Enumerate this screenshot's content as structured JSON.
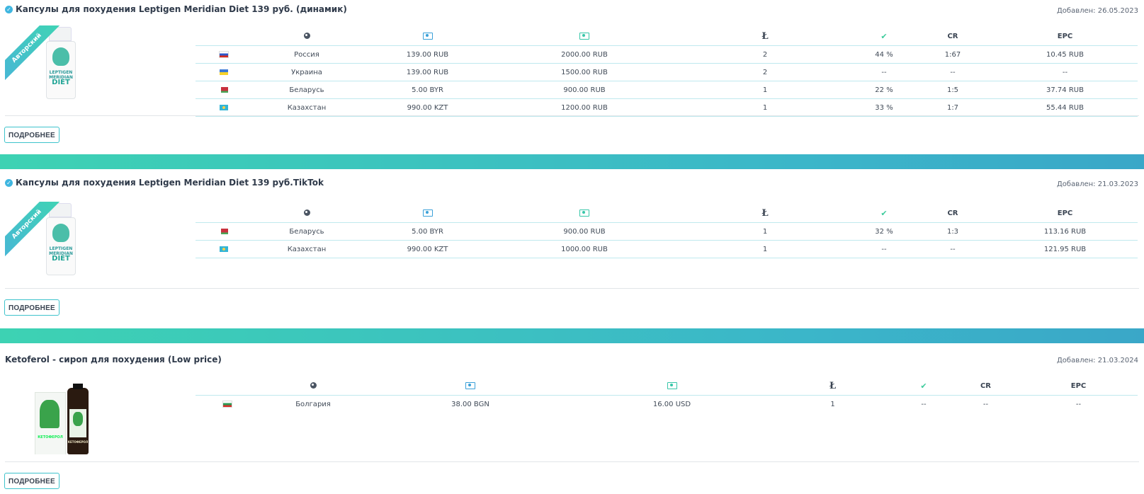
{
  "offers": [
    {
      "title": "Капсулы для похудения Leptigen Meridian Diet 139 руб. (динамик)",
      "date": "Добавлен: 26.05.2023",
      "ribbon": "Авторский",
      "product_text": [
        "LEPTIGEN",
        "MERIDIAN",
        "DIET"
      ],
      "rows": [
        {
          "country": "Россия",
          "flag": "ru",
          "price": "139.00 RUB",
          "payout": "2000.00 RUB",
          "hold": "2",
          "approve": "44 %",
          "cr": "1:67",
          "epc": "10.45 RUB"
        },
        {
          "country": "Украина",
          "flag": "ua",
          "price": "139.00 RUB",
          "payout": "1500.00 RUB",
          "hold": "2",
          "approve": "--",
          "cr": "--",
          "epc": "--"
        },
        {
          "country": "Беларусь",
          "flag": "by",
          "price": "5.00 BYR",
          "payout": "900.00 RUB",
          "hold": "1",
          "approve": "22 %",
          "cr": "1:5",
          "epc": "37.74 RUB"
        },
        {
          "country": "Казахстан",
          "flag": "kz",
          "price": "990.00 KZT",
          "payout": "1200.00 RUB",
          "hold": "1",
          "approve": "33 %",
          "cr": "1:7",
          "epc": "55.44 RUB"
        }
      ]
    },
    {
      "title": "Капсулы для похудения Leptigen Meridian Diet 139 руб.TikTok",
      "date": "Добавлен: 21.03.2023",
      "ribbon": "Авторский",
      "product_text": [
        "LEPTIGEN",
        "MERIDIAN",
        "DIET"
      ],
      "rows": [
        {
          "country": "Беларусь",
          "flag": "by",
          "price": "5.00 BYR",
          "payout": "900.00 RUB",
          "hold": "1",
          "approve": "32 %",
          "cr": "1:3",
          "epc": "113.16 RUB"
        },
        {
          "country": "Казахстан",
          "flag": "kz",
          "price": "990.00 KZT",
          "payout": "1000.00 RUB",
          "hold": "1",
          "approve": "--",
          "cr": "--",
          "epc": "121.95 RUB"
        }
      ]
    },
    {
      "title": "Ketoferol - сироп для похудения (Low price)",
      "date": "Добавлен: 21.03.2024",
      "product_text": [
        "КЕТОФЕРОЛ",
        "КЕТОФЕРОЛ"
      ],
      "rows": [
        {
          "country": "Болгария",
          "flag": "bg",
          "price": "38.00 BGN",
          "payout": "16.00 USD",
          "hold": "1",
          "approve": "--",
          "cr": "--",
          "epc": "--"
        }
      ]
    }
  ],
  "columns": {
    "country_icon": "globe-icon",
    "price_icon": "money-icon",
    "payout_icon": "money-icon",
    "hold_icon": "hold-icon",
    "approve_icon": "check-icon",
    "cr": "CR",
    "epc": "EPC"
  },
  "more_label": "ПОДРОБНЕЕ",
  "colors": {
    "accent_teal": "#3dd2b3",
    "accent_blue": "#3aa7c8",
    "border_cyan": "#3ec3cc"
  }
}
